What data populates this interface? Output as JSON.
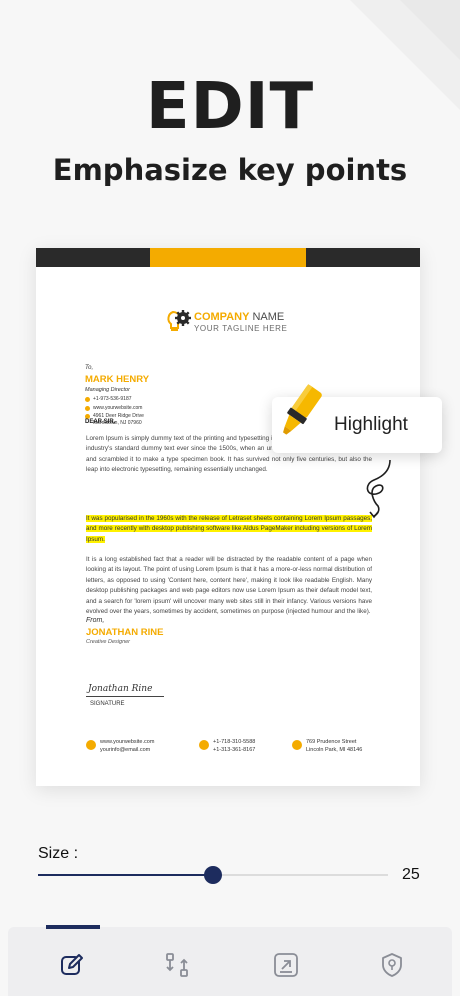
{
  "header": {
    "title": "EDIT",
    "subtitle": "Emphasize key points"
  },
  "document": {
    "company_name_1": "COMPANY",
    "company_name_2": " NAME",
    "tagline": "YOUR TAGLINE HERE",
    "to_label": "To,",
    "recipient_name": "MARK HENRY",
    "recipient_title": "Managing Director",
    "recipient_phone": "+1-973-536-9187",
    "recipient_web": "www.yourwebsite.com",
    "recipient_address_1": "4961 Deer Ridge Drive",
    "recipient_address_2": "Morristown, NJ 07960",
    "salutation": "DEAR SIR,",
    "paragraph_1": "Lorem Ipsum is simply dummy text of the printing and typesetting industry. Lorem Ipsum has been the industry's standard dummy text ever since the 1500s, when an unknown printer took a galley of type and scrambled it to make a type specimen book. It has survived not only five centuries, but also the leap into electronic typesetting, remaining essentially unchanged.",
    "paragraph_2": "It was popularised in the 1960s with the release of Letraset sheets containing Lorem Ipsum passages, and more recently with desktop publishing software like Aldus PageMaker including versions of Lorem Ipsum.",
    "paragraph_3": "It is a long established fact that a reader will be distracted by the readable content of a page when looking at its layout. The point of using Lorem Ipsum is that it has a more-or-less normal distribution of letters, as opposed to using 'Content here, content here', making it look like readable English. Many desktop publishing packages and web page editors now use Lorem Ipsum as their default model text, and a search for 'lorem ipsum' will uncover many web sites still in their infancy. Various versions have evolved over the years, sometimes by accident, sometimes on purpose (injected humour and the like).",
    "from_label": "From,",
    "sender_name": "JONATHAN RINE",
    "sender_title": "Creative Designer",
    "signature_script": "Jonathan Rine",
    "signature_label": "SIGNATURE",
    "footer_web_1": "www.yourwebsite.com",
    "footer_web_2": "yourinfo@email.com",
    "footer_phone_1": "+1-718-310-5588",
    "footer_phone_2": "+1-313-361-8167",
    "footer_addr_1": "769 Prudence Street",
    "footer_addr_2": "Lincoln Park, MI 48146"
  },
  "callout": {
    "label": "Highlight",
    "icon": "highlighter-icon"
  },
  "size_control": {
    "label": "Size :",
    "value": "25",
    "fraction": 0.5
  },
  "bottom_nav": {
    "items": [
      "edit-icon",
      "convert-icon",
      "export-icon",
      "location-shield-icon"
    ],
    "active_index": 0
  },
  "colors": {
    "accent": "#f4ab00",
    "highlight": "#fff200",
    "primary": "#1d2c5e",
    "dark": "#2a2a2a"
  }
}
